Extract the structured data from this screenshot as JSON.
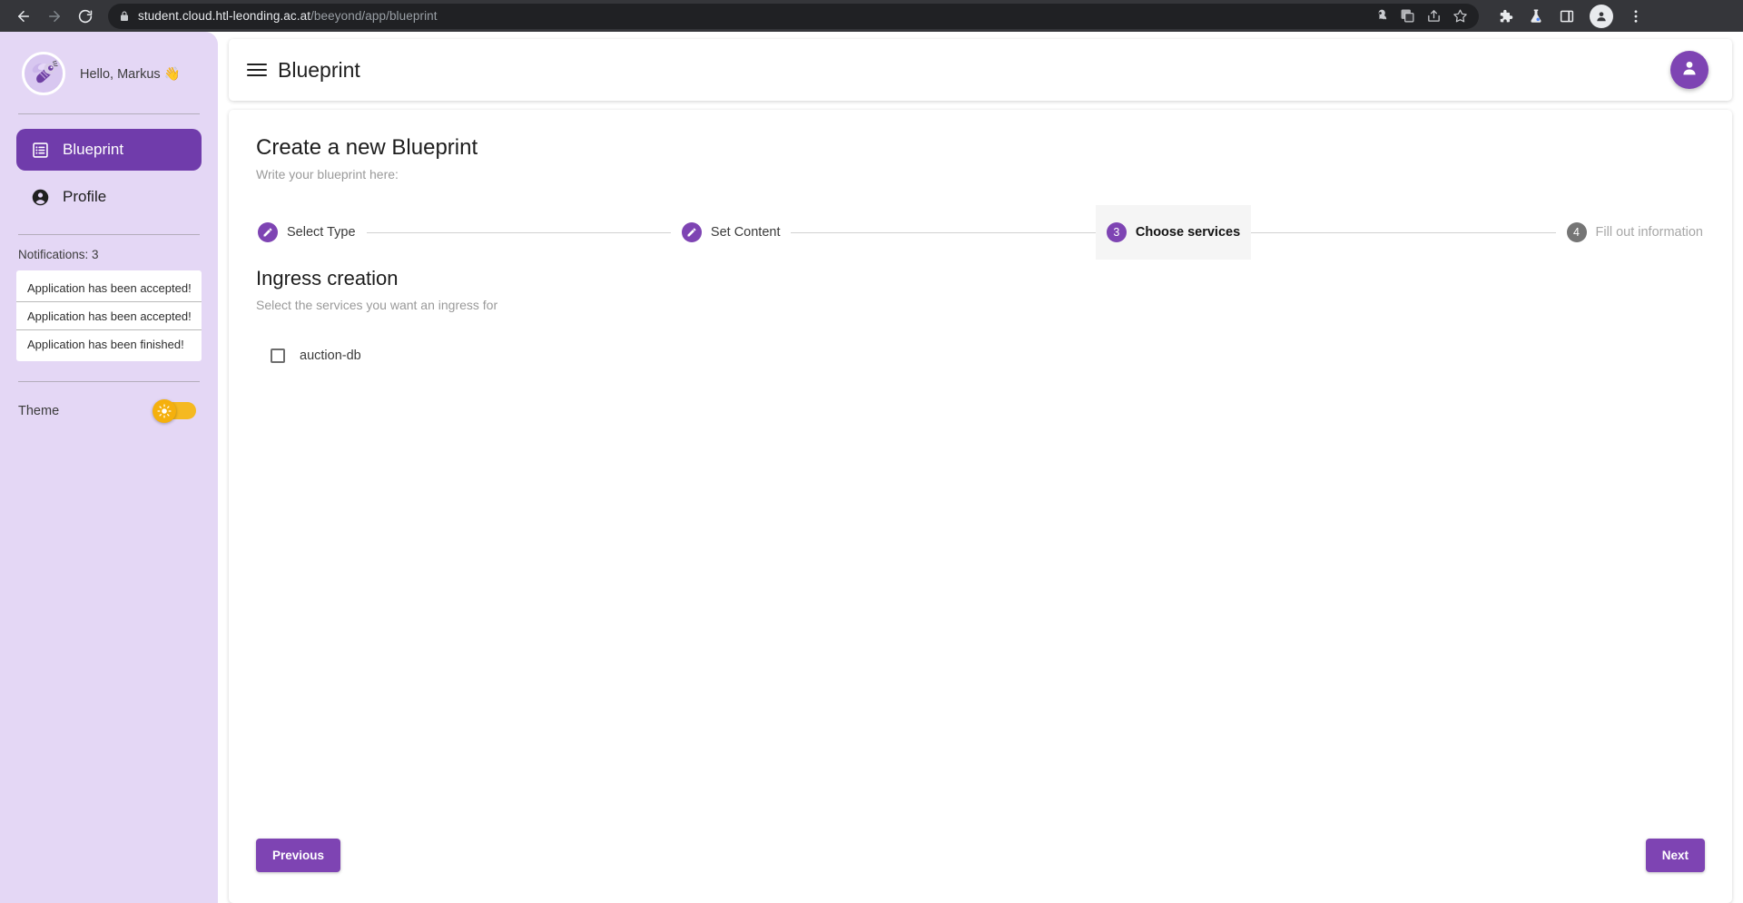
{
  "browser": {
    "back_icon": "arrow-left-icon",
    "forward_icon": "arrow-right-icon",
    "reload_icon": "reload-icon",
    "lock_icon": "lock-icon",
    "url_domain": "student.cloud.htl-leonding.ac.at",
    "url_path": "/beeyond/app/blueprint",
    "omnibox_icons": [
      "password-key-icon",
      "translate-icon",
      "share-icon",
      "bookmark-star-icon"
    ],
    "toolbar_icons": [
      "extensions-puzzle-icon",
      "labs-flask-icon",
      "side-panel-icon",
      "profile-avatar-icon",
      "more-menu-icon"
    ]
  },
  "sidebar": {
    "avatar_icon": "bee-avatar",
    "greeting": "Hello, Markus 👋",
    "nav": [
      {
        "label": "Blueprint",
        "icon": "list-alt-icon",
        "active": true
      },
      {
        "label": "Profile",
        "icon": "account-circle-icon",
        "active": false
      }
    ],
    "notifications_title": "Notifications: 3",
    "notifications": [
      "Application has been accepted!",
      "Application has been accepted!",
      "Application has been finished!"
    ],
    "theme_label": "Theme",
    "theme_toggle_icon": "sun-icon",
    "theme_toggle_on": true,
    "accent_color": "#703cab",
    "background_color": "#e4d7f5",
    "toggle_color": "#f5b921"
  },
  "topbar": {
    "menu_icon": "hamburger-menu-icon",
    "title": "Blueprint",
    "avatar_icon": "person-icon"
  },
  "main": {
    "title": "Create a new Blueprint",
    "subtitle": "Write your blueprint here:",
    "steps": [
      {
        "number": "1",
        "label": "Select Type",
        "state": "done",
        "icon": "edit-pencil-icon"
      },
      {
        "number": "2",
        "label": "Set Content",
        "state": "done",
        "icon": "edit-pencil-icon"
      },
      {
        "number": "3",
        "label": "Choose services",
        "state": "active",
        "icon": ""
      },
      {
        "number": "4",
        "label": "Fill out information",
        "state": "upcoming",
        "icon": ""
      }
    ],
    "panel": {
      "title": "Ingress creation",
      "subtitle": "Select the services you want an ingress for",
      "services": [
        {
          "name": "auction-db",
          "checked": false
        }
      ]
    },
    "previous_button": "Previous",
    "next_button": "Next",
    "button_color": "#7e44b3"
  }
}
